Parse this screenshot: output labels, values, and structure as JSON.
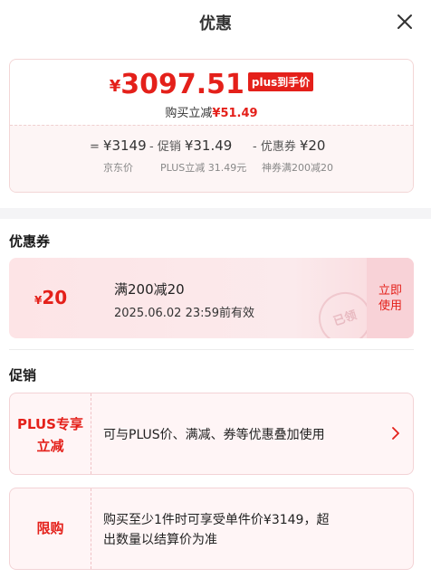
{
  "header": {
    "title": "优惠",
    "close_icon": "close-icon"
  },
  "price": {
    "symbol": "¥",
    "value": "3097.51",
    "tag": "plus到手价",
    "save_label": "购买立减",
    "save_amount": "¥51.49"
  },
  "breakdown": [
    {
      "op": "=",
      "value": "¥3149",
      "label": "京东价"
    },
    {
      "op": "- 促销",
      "value": "¥31.49",
      "label": "PLUS立减 31.49元"
    },
    {
      "op": "- 优惠券",
      "value": "¥20",
      "label": "神券满200减20"
    }
  ],
  "coupons_section": {
    "title": "优惠券",
    "coupon": {
      "symbol": "¥",
      "amount": "20",
      "name": "满200减20",
      "expiry": "2025.06.02 23:59前有效",
      "stamp": "已领",
      "action": [
        "立即",
        "使用"
      ]
    }
  },
  "promotions_section": {
    "title": "促销",
    "items": [
      {
        "tag_lines": [
          "PLUS专享",
          "立减"
        ],
        "desc_lines": [
          "可与PLUS价、满减、券等优惠叠加使用"
        ],
        "has_chevron": true
      },
      {
        "tag_lines": [
          "限购"
        ],
        "desc_lines": [
          "购买至少1件时可享受单件价¥3149，超",
          "出数量以结算价为准"
        ],
        "has_chevron": false
      }
    ]
  },
  "colors": {
    "accent": "#e4201a",
    "card_bg": "#fff5f6",
    "coupon_bg": "#fde4e6"
  }
}
